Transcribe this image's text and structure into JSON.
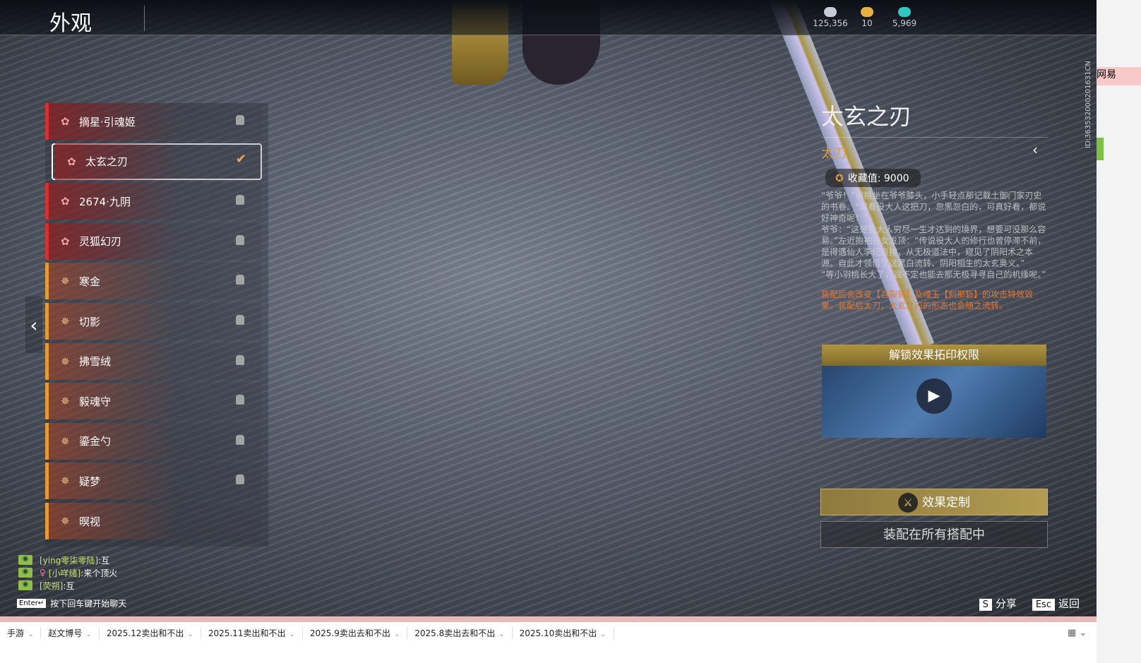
{
  "header": {
    "title": "外观"
  },
  "currencies": [
    {
      "icon": "silver-coin-icon",
      "value": "125,356",
      "color": "#c8ccd3"
    },
    {
      "icon": "gold-ticket-icon",
      "value": "10",
      "color": "#e8b040"
    },
    {
      "icon": "jade-feather-icon",
      "value": "5,969",
      "color": "#30c8c0"
    }
  ],
  "list": {
    "items": [
      {
        "label": "摘星·引魂姬",
        "rarity": "red",
        "state": "locked"
      },
      {
        "label": "太玄之刃",
        "rarity": "red",
        "state": "equipped"
      },
      {
        "label": "2674·九阴",
        "rarity": "red",
        "state": "locked"
      },
      {
        "label": "灵狐幻刃",
        "rarity": "red",
        "state": "locked"
      },
      {
        "label": "寒金",
        "rarity": "orange",
        "state": "locked"
      },
      {
        "label": "切影",
        "rarity": "orange",
        "state": "locked"
      },
      {
        "label": "拂雪绒",
        "rarity": "orange",
        "state": "locked"
      },
      {
        "label": "毅魂守",
        "rarity": "orange",
        "state": "locked"
      },
      {
        "label": "鎏金勺",
        "rarity": "orange",
        "state": "locked"
      },
      {
        "label": "疑梦",
        "rarity": "orange",
        "state": "locked"
      },
      {
        "label": "暝视",
        "rarity": "orange",
        "state": "none"
      }
    ],
    "colors": {
      "red": "#d8302a",
      "orange": "#e89a30"
    }
  },
  "chat": {
    "messages": [
      {
        "name": "[ying零柒零陆]",
        "text": ":互"
      },
      {
        "name": "[小咩绪]",
        "text": ":来个顶火"
      },
      {
        "name": "[荧朔]",
        "text": ":互"
      }
    ],
    "enter_key": "Enter↵",
    "hint": "按下回车键开始聊天"
  },
  "detail": {
    "name": "太玄之刃",
    "type": "太刀",
    "collection": "收藏值: 9000",
    "desc": [
      "“爷爷！”羽桃坐在爷爷膝头，小手轻点那记载土御门家刃史的书卷。“您看役大人这把刀，忽黑忽白的，可真好看，都说好神奇呢！”",
      "爷爷：“这是役大人穷尽一生才达到的境界，想要可没那么容易。”左近抱拍孙女发顶：“传说役大人的修行也曾停滞不前，是得遇仙人李纪点拨，从无极道法中，窥见了阴阳术之本源。自此才领悟了这黑白流转、阴阳相生的太玄奥义。”",
      "“等小羽桃长大了，说不定也能去那无极寻寻自己的机缘呢。”"
    ],
    "effect": "装配后会改变【百裂斩】及魂玉【刹那斩】的攻击特效效果。装配后太刀，太玄之刃的形态也会随之流转。",
    "unlock_title": "解锁效果拓印权限",
    "customize": "效果定制",
    "equip_all": "装配在所有搭配中"
  },
  "keys": [
    {
      "key": "S",
      "label": "分享"
    },
    {
      "key": "Esc",
      "label": "返回"
    }
  ],
  "overlay_id": "ID:363532000201631CN",
  "side_strip": {
    "text": "网易"
  },
  "taskbar": {
    "tabs": [
      "手游",
      "赵文博号",
      "2025.12卖出和不出",
      "2025.11卖出和不出",
      "2025.9卖出去和不出",
      "2025.8卖出去和不出",
      "2025.10卖出和不出"
    ]
  }
}
